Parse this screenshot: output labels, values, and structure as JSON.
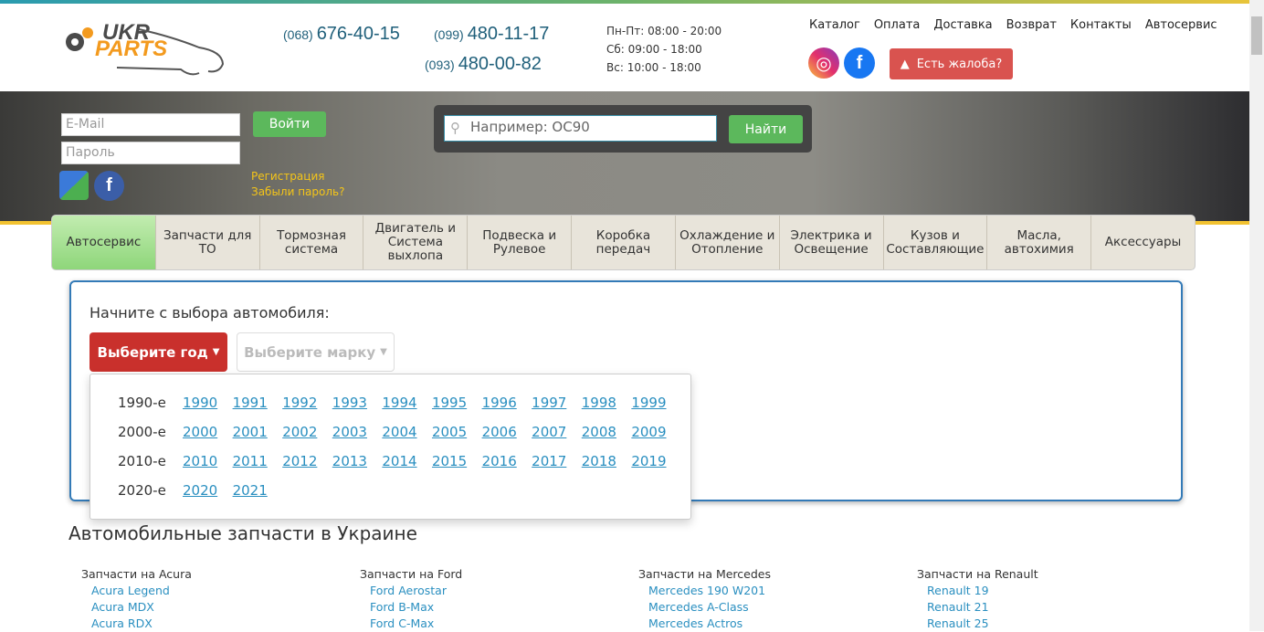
{
  "logo": {
    "line1": "UKR",
    "line2": "PARTS"
  },
  "phones": [
    {
      "code": "(068)",
      "number": "676-40-15"
    },
    {
      "code": "(099)",
      "number": "480-11-17"
    },
    {
      "code": "(093)",
      "number": "480-00-82"
    }
  ],
  "hours": [
    "Пн-Пт: 08:00 - 20:00",
    "Сб: 09:00 - 18:00",
    "Вс: 10:00 - 18:00"
  ],
  "topnav": [
    "Каталог",
    "Оплата",
    "Доставка",
    "Возврат",
    "Контакты",
    "Автосервис"
  ],
  "complaint": "Есть жалоба?",
  "login": {
    "email_placeholder": "E-Mail",
    "password_placeholder": "Пароль",
    "submit": "Войти",
    "register": "Регистрация",
    "forgot": "Забыли пароль?"
  },
  "search": {
    "placeholder": "Например: OC90",
    "button": "Найти"
  },
  "tabs": [
    "Автосервис",
    "Запчасти для ТО",
    "Тормозная система",
    "Двигатель и Система выхлопа",
    "Подвеска и Рулевое",
    "Коробка передач",
    "Охлаждение и Отопление",
    "Электрика и Освещение",
    "Кузов и Составляющие",
    "Масла, автохимия",
    "Аксессуары"
  ],
  "selector": {
    "title": "Начните с выбора автомобиля:",
    "year_button": "Выберите год",
    "brand_button": "Выберите марку"
  },
  "decades": [
    {
      "label": "1990-е",
      "years": [
        "1990",
        "1991",
        "1992",
        "1993",
        "1994",
        "1995",
        "1996",
        "1997",
        "1998",
        "1999"
      ]
    },
    {
      "label": "2000-е",
      "years": [
        "2000",
        "2001",
        "2002",
        "2003",
        "2004",
        "2005",
        "2006",
        "2007",
        "2008",
        "2009"
      ]
    },
    {
      "label": "2010-е",
      "years": [
        "2010",
        "2011",
        "2012",
        "2013",
        "2014",
        "2015",
        "2016",
        "2017",
        "2018",
        "2019"
      ]
    },
    {
      "label": "2020-е",
      "years": [
        "2020",
        "2021"
      ]
    }
  ],
  "section_title": "Автомобильные запчасти в Украине",
  "brands": [
    {
      "title": "Запчасти на Acura",
      "models": [
        "Acura Legend",
        "Acura MDX",
        "Acura RDX"
      ]
    },
    {
      "title": "Запчасти на Ford",
      "models": [
        "Ford Aerostar",
        "Ford B-Max",
        "Ford C-Max"
      ]
    },
    {
      "title": "Запчасти на Mercedes",
      "models": [
        "Mercedes 190 W201",
        "Mercedes A-Class",
        "Mercedes Actros"
      ]
    },
    {
      "title": "Запчасти на Renault",
      "models": [
        "Renault 19",
        "Renault 21",
        "Renault 25"
      ]
    }
  ]
}
